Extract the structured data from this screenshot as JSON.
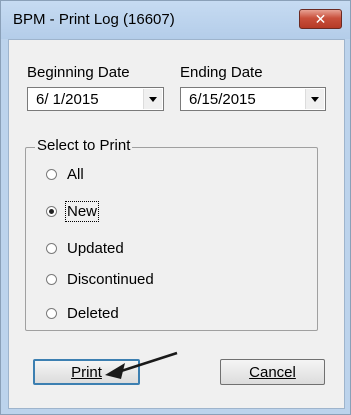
{
  "window": {
    "title": "BPM - Print Log (16607)",
    "close_glyph": "✕"
  },
  "dates": {
    "beginning_label": "Beginning Date",
    "beginning_value": "6/ 1/2015",
    "ending_label": "Ending Date",
    "ending_value": "6/15/2015"
  },
  "select": {
    "title": "Select to Print",
    "options": [
      {
        "label": "All",
        "selected": false
      },
      {
        "label": "New",
        "selected": true
      },
      {
        "label": "Updated",
        "selected": false
      },
      {
        "label": "Discontinued",
        "selected": false
      },
      {
        "label": "Deleted",
        "selected": false
      }
    ]
  },
  "buttons": {
    "print": "Print",
    "cancel": "Cancel"
  },
  "colors": {
    "titlebar": "#bcd3ec",
    "client": "#f0f0f0",
    "close": "#c9503c",
    "default_border": "#3c7fb1"
  },
  "icons": {
    "close": "close-icon",
    "dropdown": "chevron-down-icon",
    "annotation": "arrow-annotation"
  }
}
